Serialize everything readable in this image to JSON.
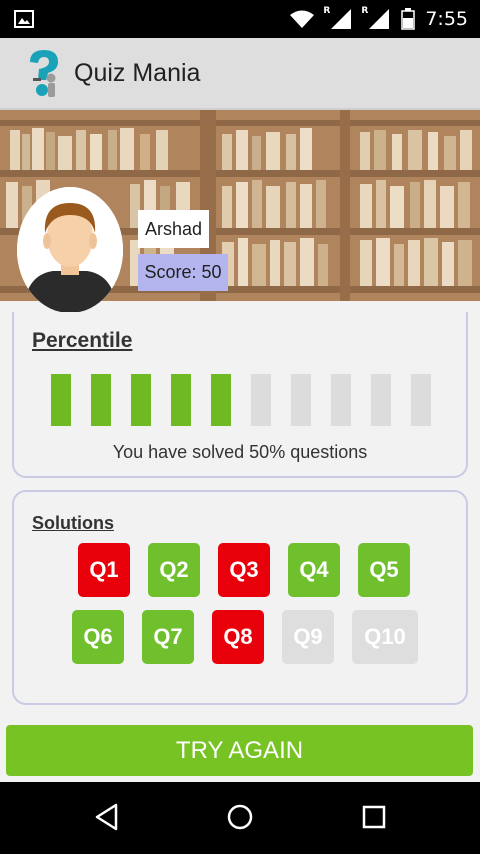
{
  "status_bar": {
    "time": "7:55",
    "roaming_label": "R",
    "icons": [
      "image-icon",
      "wifi-icon",
      "signal-icon",
      "battery-icon"
    ]
  },
  "app_bar": {
    "title": "Quiz Mania",
    "logo": "quiz-logo-icon"
  },
  "profile": {
    "name": "Arshad",
    "score_text": "Score: 50"
  },
  "percentile": {
    "title": "Percentile",
    "filled": 5,
    "total": 10,
    "summary": "You have solved 50% questions",
    "colors": {
      "filled": "#6fba22",
      "empty": "#dcdcdc"
    }
  },
  "solutions": {
    "title": "Solutions",
    "questions": [
      {
        "label": "Q1",
        "status": "wrong"
      },
      {
        "label": "Q2",
        "status": "right"
      },
      {
        "label": "Q3",
        "status": "wrong"
      },
      {
        "label": "Q4",
        "status": "right"
      },
      {
        "label": "Q5",
        "status": "right"
      },
      {
        "label": "Q6",
        "status": "right"
      },
      {
        "label": "Q7",
        "status": "right"
      },
      {
        "label": "Q8",
        "status": "wrong"
      },
      {
        "label": "Q9",
        "status": "none"
      },
      {
        "label": "Q10",
        "status": "none"
      }
    ],
    "colors": {
      "right": "#6fc02c",
      "wrong": "#e8000b",
      "none": "#dedede"
    }
  },
  "actions": {
    "try_again": "TRY AGAIN"
  },
  "nav_bar": {
    "icons": [
      "back-icon",
      "home-icon",
      "recents-icon"
    ]
  }
}
